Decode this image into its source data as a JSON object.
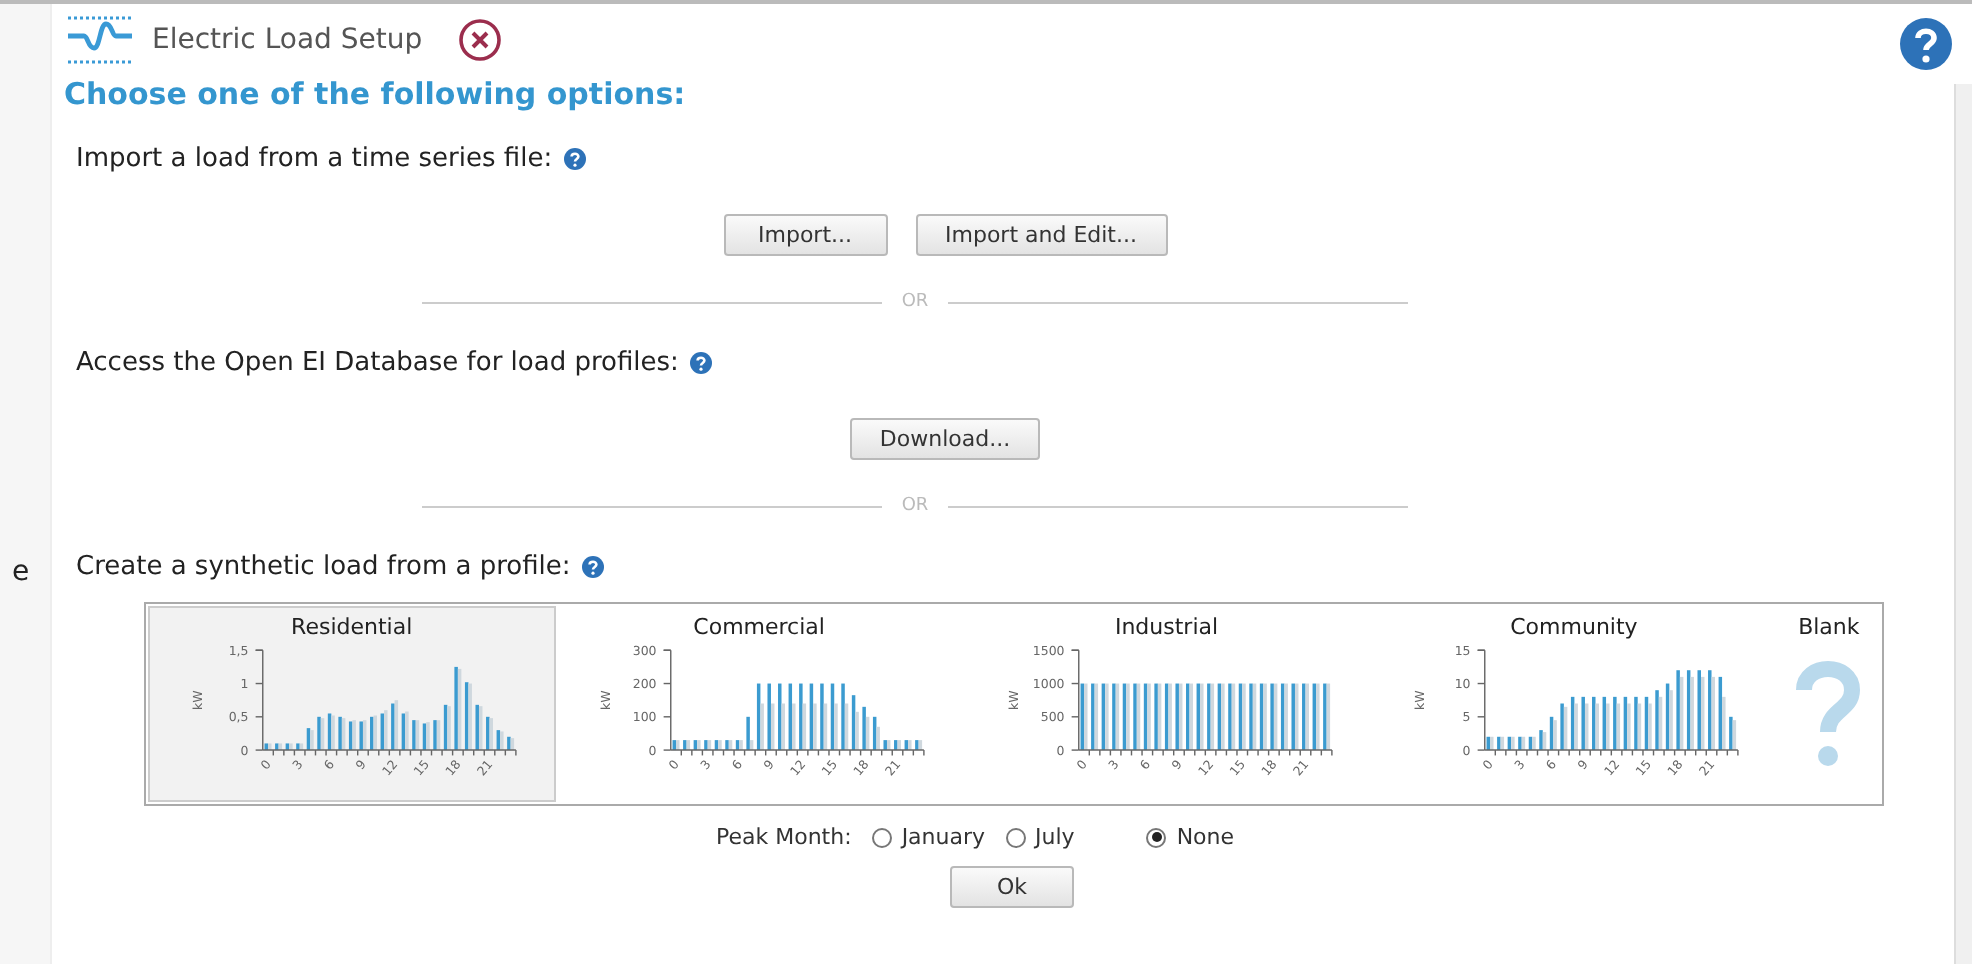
{
  "window": {
    "title": "Electric Load Setup"
  },
  "left_panel": {
    "text": "e"
  },
  "heading": "Choose one of the following options:",
  "sections": [
    {
      "kind": "buttons",
      "label": "Import a load from a time series file:",
      "buttons": [
        "Import...",
        "Import and Edit..."
      ],
      "separator": "OR"
    },
    {
      "kind": "buttons",
      "label": "Access the Open EI Database for load profiles:",
      "buttons": [
        "Download..."
      ],
      "separator": "OR"
    },
    {
      "kind": "profiles",
      "label": "Create a synthetic load from a profile:"
    }
  ],
  "profiles": [
    {
      "kind": "chart",
      "selected": true,
      "title": "Residential",
      "chart_data": {
        "type": "bar",
        "stacked": false,
        "ylabel": "kW",
        "xlim": [
          -0.5,
          23.5
        ],
        "x": [
          0,
          1,
          2,
          3,
          4,
          5,
          6,
          7,
          8,
          9,
          10,
          11,
          12,
          13,
          14,
          15,
          16,
          17,
          18,
          19,
          20,
          21,
          22,
          23
        ],
        "xticks": [
          0,
          3,
          6,
          9,
          12,
          15,
          18,
          21
        ],
        "ylim": [
          0,
          1.5
        ],
        "yticks": [
          0,
          {
            "value": 0.5,
            "label": "0,5"
          },
          1,
          {
            "value": 1.5,
            "label": "1,5"
          }
        ],
        "series": [
          {
            "color": "#3b9bd0",
            "values": [
              0.1,
              0.1,
              0.1,
              0.1,
              0.33,
              0.5,
              0.55,
              0.5,
              0.43,
              0.43,
              0.5,
              0.55,
              0.7,
              0.55,
              0.45,
              0.4,
              0.45,
              0.68,
              1.25,
              1.02,
              0.68,
              0.5,
              0.3,
              0.2
            ]
          },
          {
            "color": "#cfd8de",
            "values": [
              0.1,
              0.1,
              0.1,
              0.1,
              0.3,
              0.48,
              0.52,
              0.48,
              0.45,
              0.45,
              0.52,
              0.6,
              0.75,
              0.58,
              0.45,
              0.42,
              0.45,
              0.66,
              1.22,
              1.0,
              0.66,
              0.48,
              0.28,
              0.18
            ]
          }
        ]
      }
    },
    {
      "kind": "chart",
      "selected": false,
      "title": "Commercial",
      "chart_data": {
        "type": "bar",
        "stacked": false,
        "ylabel": "kW",
        "xlim": [
          -0.5,
          23.5
        ],
        "x": [
          0,
          1,
          2,
          3,
          4,
          5,
          6,
          7,
          8,
          9,
          10,
          11,
          12,
          13,
          14,
          15,
          16,
          17,
          18,
          19,
          20,
          21,
          22,
          23
        ],
        "xticks": [
          0,
          3,
          6,
          9,
          12,
          15,
          18,
          21
        ],
        "ylim": [
          0,
          300
        ],
        "yticks": [
          0,
          100,
          200,
          300
        ],
        "series": [
          {
            "color": "#3b9bd0",
            "values": [
              30,
              30,
              30,
              30,
              30,
              30,
              30,
              100,
              200,
              200,
              200,
              200,
              200,
              200,
              200,
              200,
              200,
              165,
              130,
              100,
              30,
              30,
              30,
              30
            ]
          },
          {
            "color": "#cfd8de",
            "values": [
              30,
              30,
              30,
              30,
              30,
              30,
              30,
              30,
              140,
              140,
              140,
              140,
              140,
              140,
              140,
              140,
              140,
              115,
              100,
              70,
              30,
              30,
              30,
              30
            ]
          }
        ]
      }
    },
    {
      "kind": "chart",
      "selected": false,
      "title": "Industrial",
      "chart_data": {
        "type": "bar",
        "stacked": false,
        "ylabel": "kW",
        "xlim": [
          -0.5,
          23.5
        ],
        "x": [
          0,
          1,
          2,
          3,
          4,
          5,
          6,
          7,
          8,
          9,
          10,
          11,
          12,
          13,
          14,
          15,
          16,
          17,
          18,
          19,
          20,
          21,
          22,
          23
        ],
        "xticks": [
          0,
          3,
          6,
          9,
          12,
          15,
          18,
          21
        ],
        "ylim": [
          0,
          1500
        ],
        "yticks": [
          0,
          500,
          1000,
          1500
        ],
        "series": [
          {
            "color": "#3b9bd0",
            "values": [
              1000,
              1000,
              1000,
              1000,
              1000,
              1000,
              1000,
              1000,
              1000,
              1000,
              1000,
              1000,
              1000,
              1000,
              1000,
              1000,
              1000,
              1000,
              1000,
              1000,
              1000,
              1000,
              1000,
              1000
            ]
          },
          {
            "color": "#cfd8de",
            "values": [
              1000,
              1000,
              1000,
              1000,
              1000,
              1000,
              1000,
              1000,
              1000,
              1000,
              1000,
              1000,
              1000,
              1000,
              1000,
              1000,
              1000,
              1000,
              1000,
              1000,
              1000,
              1000,
              1000,
              1000
            ]
          }
        ]
      }
    },
    {
      "kind": "chart",
      "selected": false,
      "title": "Community",
      "chart_data": {
        "type": "bar",
        "stacked": false,
        "ylabel": "kW",
        "xlim": [
          -0.5,
          23.5
        ],
        "x": [
          0,
          1,
          2,
          3,
          4,
          5,
          6,
          7,
          8,
          9,
          10,
          11,
          12,
          13,
          14,
          15,
          16,
          17,
          18,
          19,
          20,
          21,
          22,
          23
        ],
        "xticks": [
          0,
          3,
          6,
          9,
          12,
          15,
          18,
          21
        ],
        "ylim": [
          0,
          15
        ],
        "yticks": [
          0,
          5,
          10,
          15
        ],
        "series": [
          {
            "color": "#3b9bd0",
            "values": [
              2,
              2,
              2,
              2,
              2,
              3,
              5,
              7,
              8,
              8,
              8,
              8,
              8,
              8,
              8,
              8,
              9,
              10,
              12,
              12,
              12,
              12,
              11,
              5
            ]
          },
          {
            "color": "#cfd8de",
            "values": [
              2,
              2,
              2,
              2,
              2,
              2.7,
              4.5,
              6.5,
              7,
              7,
              7,
              7,
              7,
              7,
              7,
              7,
              8,
              9,
              11,
              11,
              11,
              11,
              8,
              4.5
            ]
          }
        ]
      }
    },
    {
      "kind": "blank",
      "selected": false,
      "title": "Blank"
    }
  ],
  "peak_month": {
    "label": "Peak Month:",
    "options": [
      {
        "label": "January",
        "selected": false
      },
      {
        "label": "July",
        "selected": false
      },
      {
        "label": "None",
        "selected": true
      }
    ]
  },
  "ok_button": "Ok"
}
